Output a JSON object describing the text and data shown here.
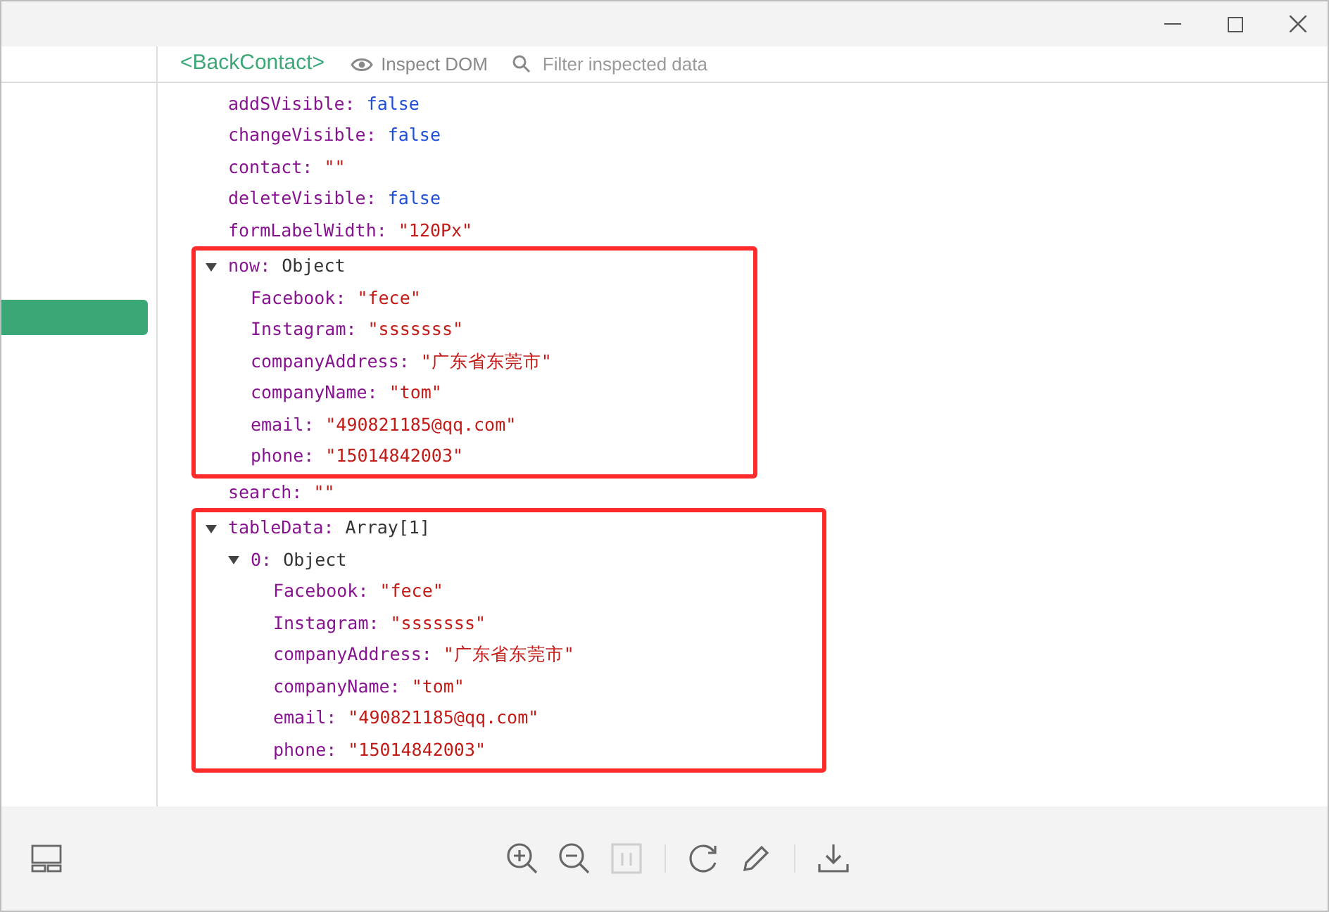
{
  "header": {
    "component": "<BackContact>",
    "inspect_dom": "Inspect DOM",
    "filter_placeholder": "Filter inspected data"
  },
  "sidebar": {
    "items": [
      {
        "selected": true
      }
    ]
  },
  "separator": ":",
  "state": [
    {
      "key": "addSVisible",
      "kind": "boolean",
      "value": "false"
    },
    {
      "key": "changeVisible",
      "kind": "boolean",
      "value": "false"
    },
    {
      "key": "contact",
      "kind": "string",
      "value": "\"\""
    },
    {
      "key": "deleteVisible",
      "kind": "boolean",
      "value": "false"
    },
    {
      "key": "formLabelWidth",
      "kind": "string",
      "value": "\"120Px\""
    },
    {
      "key": "now",
      "kind": "object",
      "value": "Object",
      "expanded": true,
      "highlighted": true,
      "children": [
        {
          "key": "Facebook",
          "kind": "string",
          "value": "\"fece\""
        },
        {
          "key": "Instagram",
          "kind": "string",
          "value": "\"sssssss\""
        },
        {
          "key": "companyAddress",
          "kind": "string",
          "value": "\"广东省东莞市\""
        },
        {
          "key": "companyName",
          "kind": "string",
          "value": "\"tom\""
        },
        {
          "key": "email",
          "kind": "string",
          "value": "\"490821185@qq.com\""
        },
        {
          "key": "phone",
          "kind": "string",
          "value": "\"15014842003\""
        }
      ]
    },
    {
      "key": "search",
      "kind": "string",
      "value": "\"\""
    },
    {
      "key": "tableData",
      "kind": "object",
      "value": "Array[1]",
      "expanded": true,
      "highlighted": true,
      "children": [
        {
          "key": "0",
          "kind": "object",
          "value": "Object",
          "expanded": true,
          "children": [
            {
              "key": "Facebook",
              "kind": "string",
              "value": "\"fece\""
            },
            {
              "key": "Instagram",
              "kind": "string",
              "value": "\"sssssss\""
            },
            {
              "key": "companyAddress",
              "kind": "string",
              "value": "\"广东省东莞市\""
            },
            {
              "key": "companyName",
              "kind": "string",
              "value": "\"tom\""
            },
            {
              "key": "email",
              "kind": "string",
              "value": "\"490821185@qq.com\""
            },
            {
              "key": "phone",
              "kind": "string",
              "value": "\"15014842003\""
            }
          ]
        }
      ]
    }
  ]
}
